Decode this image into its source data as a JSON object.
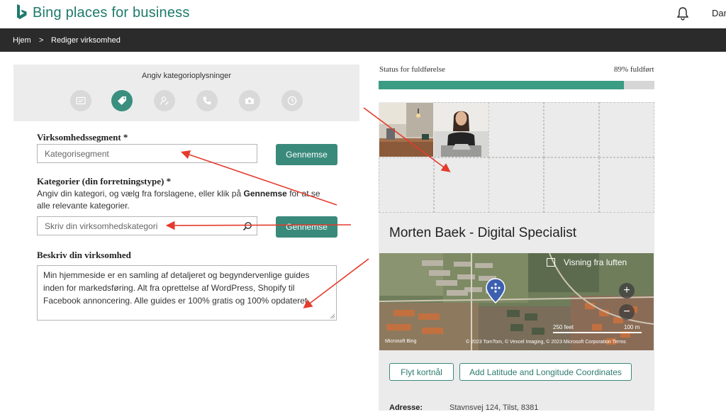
{
  "header": {
    "brand": "Bing places for business",
    "user_initials": "Dar"
  },
  "breadcrumb": {
    "home": "Hjem",
    "separator": ">",
    "current": "Rediger virksomhed"
  },
  "wizard": {
    "title": "Angiv kategorioplysninger",
    "steps": [
      {
        "icon": "id-card-icon",
        "active": false
      },
      {
        "icon": "tag-icon",
        "active": true
      },
      {
        "icon": "contact-icon",
        "active": false
      },
      {
        "icon": "phone-icon",
        "active": false
      },
      {
        "icon": "camera-icon",
        "active": false
      },
      {
        "icon": "clock-icon",
        "active": false
      }
    ]
  },
  "form": {
    "segment_label": "Virksomhedssegment *",
    "segment_placeholder": "Kategorisegment",
    "browse_label": "Gennemse",
    "categories_label": "Kategorier (din forretningstype) *",
    "categories_help_pre": "Angiv din kategori, og vælg fra forslagene, eller klik på",
    "categories_help_bold": "Gennemse",
    "categories_help_post": "for at se alle relevante kategorier.",
    "category_placeholder": "Skriv din virksomhedskategori",
    "describe_label": "Beskriv din virksomhed",
    "description_value": "Min hjemmeside er en samling af detaljeret og begyndervenlige guides inden for markedsføring. Alt fra oprettelse af WordPress, Shopify til Facebook annoncering. Alle guides er 100% gratis og 100% opdateret."
  },
  "status": {
    "label": "Status for fuldførelse",
    "percent_text": "89% fuldført",
    "percent": 89
  },
  "listing": {
    "business_name": "Morten Baek - Digital Specialist",
    "map": {
      "aerial_toggle": "Visning fra luften",
      "zoom_in": "+",
      "zoom_out": "−",
      "logo": "Microsoft Bing",
      "scale_a": "250 feet",
      "scale_b": "100 m",
      "credit": "© 2023 TomTom, © Vexcel Imaging, © 2023 Microsoft Corporation Terms"
    },
    "move_map_button": "Flyt kortnål",
    "coords_button": "Add Latitude and Longitude Coordinates",
    "address_label": "Adresse:",
    "address_value": "Stavnsvej 124, Tilst, 8381"
  },
  "colors": {
    "brand": "#1e7a6c",
    "accent": "#3a8a7c",
    "progress": "#3a9c82",
    "annotation_arrow": "#e53b2c"
  }
}
